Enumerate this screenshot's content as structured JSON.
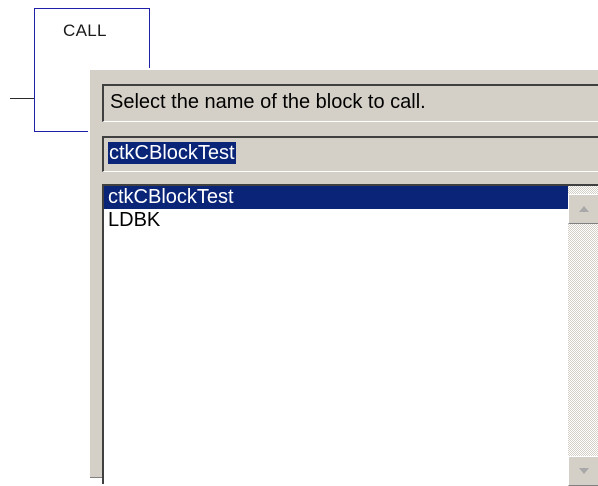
{
  "call_block": {
    "title": "CALL"
  },
  "dialog": {
    "prompt": "Select the name of the block to call.",
    "name_value": "ctkCBlockTest",
    "list_items": [
      "ctkCBlockTest",
      "LDBK"
    ],
    "selected_index": 0
  },
  "icons": {
    "scroll_up": "scroll-up-arrow-icon",
    "scroll_down": "scroll-down-arrow-icon"
  },
  "colors": {
    "selection_bg": "#0a2478",
    "block_border": "#1f1fa8",
    "dialog_bg": "#d4d0c8"
  }
}
